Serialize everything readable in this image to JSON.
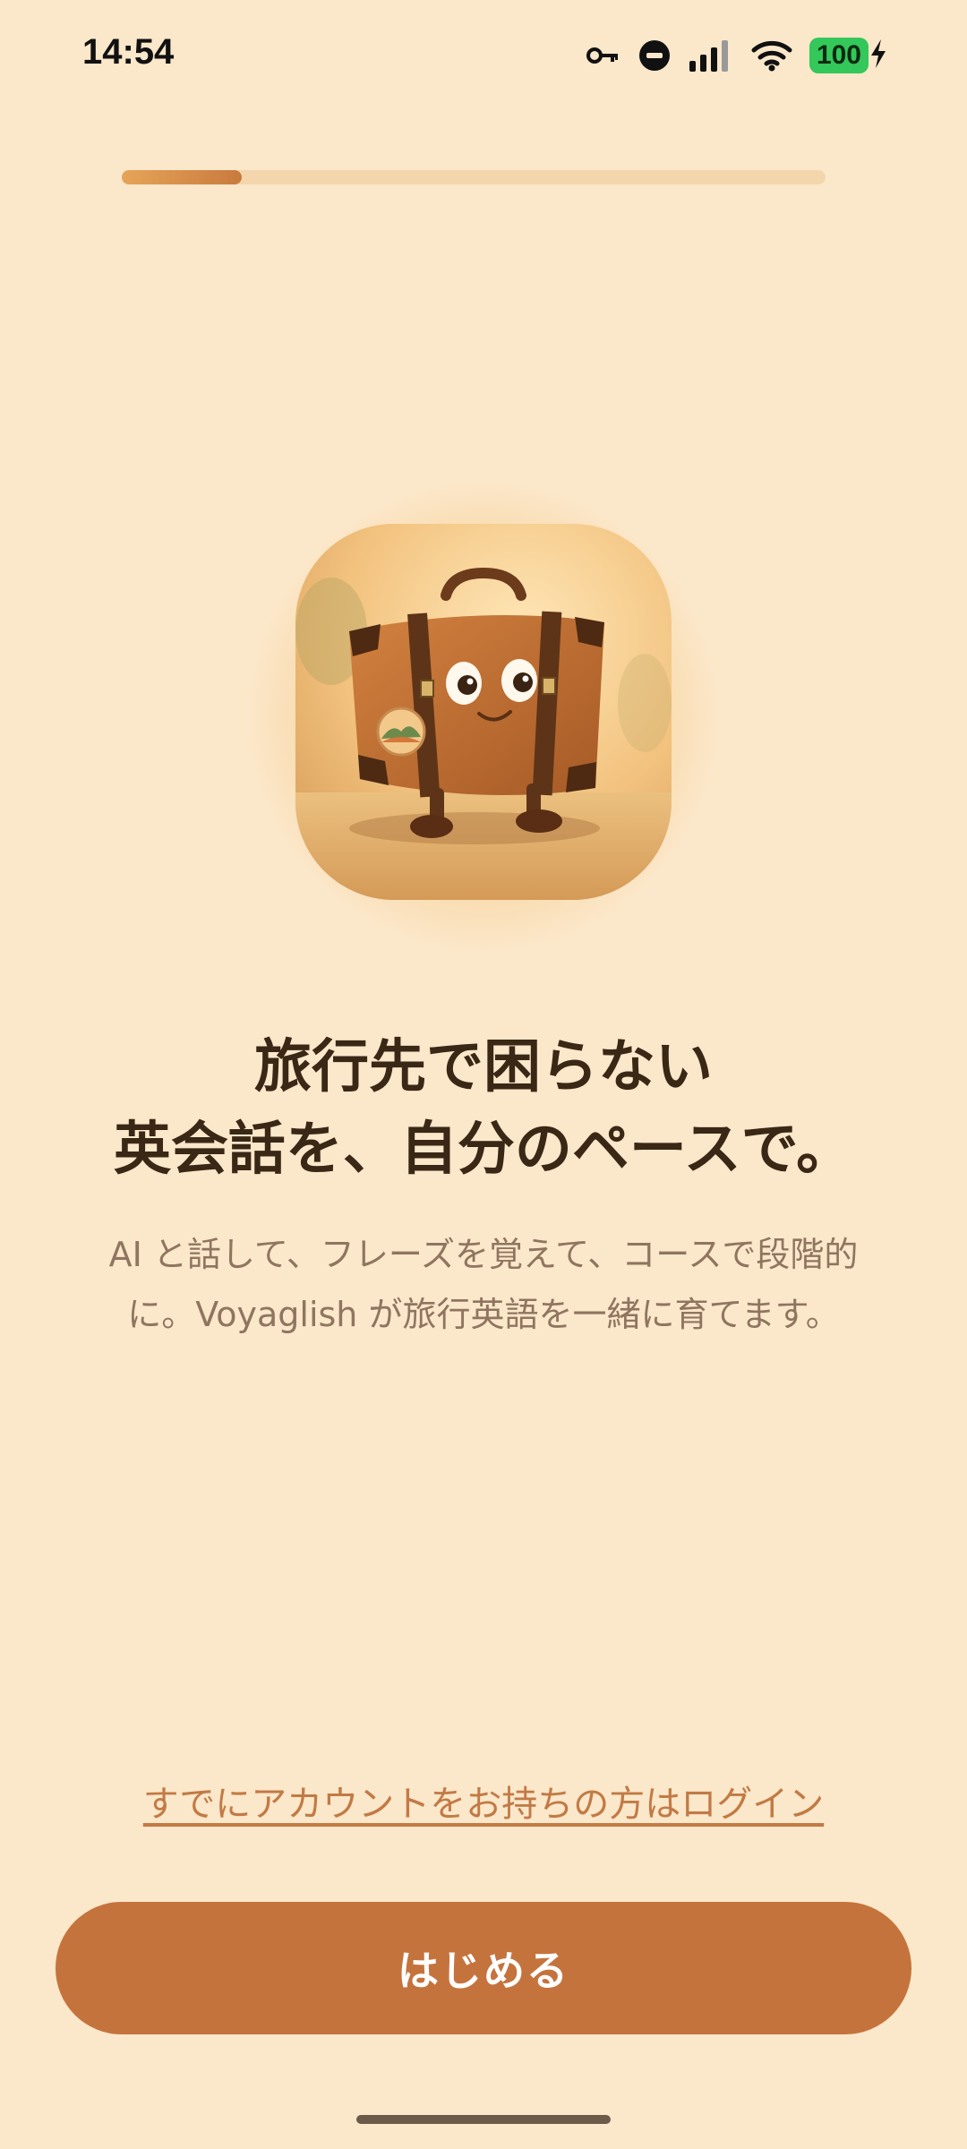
{
  "status_bar": {
    "time": "14:54",
    "battery": "100",
    "icons": [
      "vpn-key-icon",
      "do-not-disturb-icon",
      "signal-icon",
      "wifi-icon",
      "battery-charging-icon"
    ],
    "battery_color": "#34C759"
  },
  "onboarding": {
    "progress": 0.17,
    "hero_icon": "suitcase-mascot-illustration",
    "headline_line1": "旅行先で困らない",
    "headline_line2": "英会話を、自分のペースで。",
    "description_line1": "AI と話して、フレーズを覚えて、コースで段階的",
    "description_line2": "に。Voyaglish が旅行英語を一緒に育てます。",
    "login_link": "すでにアカウントをお持ちの方はログイン",
    "start_button": "はじめる"
  },
  "colors": {
    "background": "#FBE7CA",
    "accent": "#C5733D",
    "link": "#C27A45",
    "headline": "#3A2715",
    "body_text": "#8F7560"
  }
}
